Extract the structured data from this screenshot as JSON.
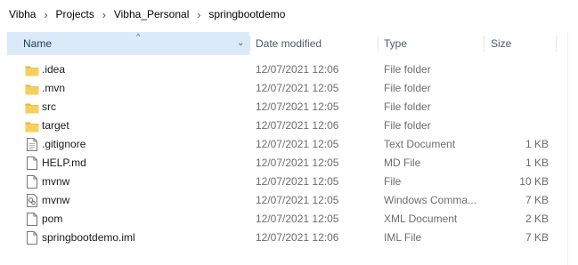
{
  "breadcrumb": [
    "Vibha",
    "Projects",
    "Vibha_Personal",
    "springbootdemo"
  ],
  "columns": {
    "name": "Name",
    "date": "Date modified",
    "type": "Type",
    "size": "Size"
  },
  "sort": {
    "column": "name",
    "direction": "ascending"
  },
  "files": [
    {
      "name": ".idea",
      "date": "12/07/2021 12:06",
      "type": "File folder",
      "size": "",
      "icon": "folder-icon"
    },
    {
      "name": ".mvn",
      "date": "12/07/2021 12:05",
      "type": "File folder",
      "size": "",
      "icon": "folder-icon"
    },
    {
      "name": "src",
      "date": "12/07/2021 12:05",
      "type": "File folder",
      "size": "",
      "icon": "folder-icon"
    },
    {
      "name": "target",
      "date": "12/07/2021 12:06",
      "type": "File folder",
      "size": "",
      "icon": "folder-icon"
    },
    {
      "name": ".gitignore",
      "date": "12/07/2021 12:05",
      "type": "Text Document",
      "size": "1 KB",
      "icon": "text-document-icon"
    },
    {
      "name": "HELP.md",
      "date": "12/07/2021 12:05",
      "type": "MD File",
      "size": "1 KB",
      "icon": "file-icon"
    },
    {
      "name": "mvnw",
      "date": "12/07/2021 12:05",
      "type": "File",
      "size": "10 KB",
      "icon": "file-icon"
    },
    {
      "name": "mvnw",
      "date": "12/07/2021 12:05",
      "type": "Windows Comma...",
      "size": "7 KB",
      "icon": "windows-command-icon"
    },
    {
      "name": "pom",
      "date": "12/07/2021 12:05",
      "type": "XML Document",
      "size": "2 KB",
      "icon": "file-icon"
    },
    {
      "name": "springbootdemo.iml",
      "date": "12/07/2021 12:06",
      "type": "IML File",
      "size": "7 KB",
      "icon": "file-icon"
    }
  ],
  "colors": {
    "folder": "#f8cf5c",
    "folder_dark": "#e6b33d",
    "header_active_bg": "#dbeaf8"
  }
}
